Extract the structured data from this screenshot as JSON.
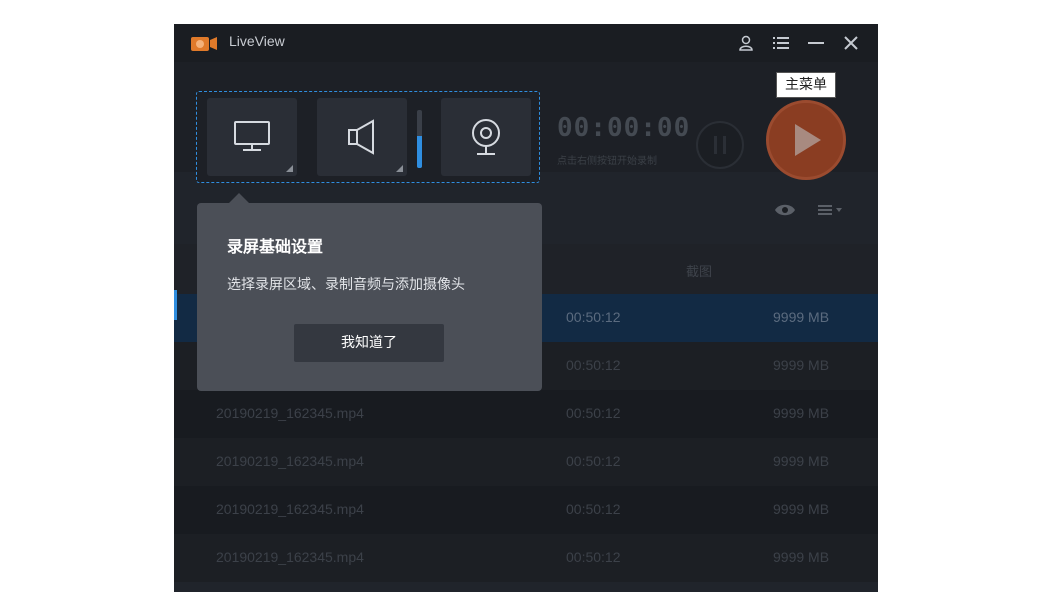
{
  "app": {
    "title": "LiveView"
  },
  "menu_tooltip": "主菜单",
  "recorder": {
    "timer": "00:00:00",
    "hint": "点击右侧按钮开始录制",
    "volume_level": 0.55
  },
  "table": {
    "header_screenshot": "截图",
    "rows": [
      {
        "file": "",
        "duration": "00:50:12",
        "size": "9999 MB",
        "selected": true
      },
      {
        "file": "",
        "duration": "00:50:12",
        "size": "9999 MB"
      },
      {
        "file": "20190219_162345.mp4",
        "duration": "00:50:12",
        "size": "9999 MB"
      },
      {
        "file": "20190219_162345.mp4",
        "duration": "00:50:12",
        "size": "9999 MB"
      },
      {
        "file": "20190219_162345.mp4",
        "duration": "00:50:12",
        "size": "9999 MB"
      },
      {
        "file": "20190219_162345.mp4",
        "duration": "00:50:12",
        "size": "9999 MB"
      }
    ]
  },
  "popover": {
    "title": "录屏基础设置",
    "description": "选择录屏区域、录制音频与添加摄像头",
    "confirm_label": "我知道了"
  },
  "colors": {
    "accent": "#2f8ee0",
    "record": "#8a3d22",
    "popover_bg": "#4b4f57"
  },
  "icons": [
    "camera-logo-icon",
    "user-icon",
    "menu-list-icon",
    "minimize-icon",
    "close-icon",
    "monitor-icon",
    "speaker-icon",
    "webcam-icon",
    "pause-icon",
    "play-icon",
    "eye-icon",
    "list-dropdown-icon"
  ]
}
